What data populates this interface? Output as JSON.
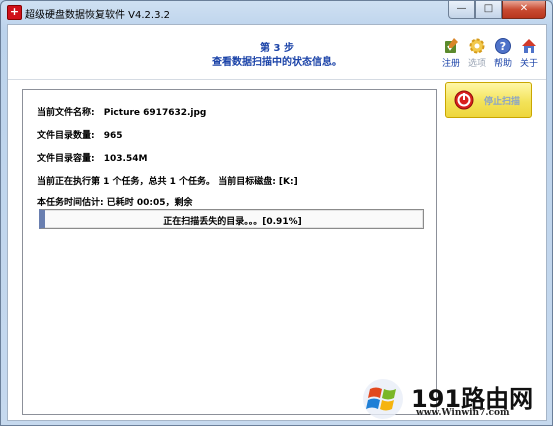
{
  "window": {
    "title": "超级硬盘数据恢复软件 V4.2.3.2",
    "controls": {
      "minimize": "—",
      "maximize": "□",
      "close": "✕"
    }
  },
  "header": {
    "step": "第 3 步",
    "subtitle": "查看数据扫描中的状态信息。"
  },
  "toolbar": {
    "items": [
      {
        "label": "注册",
        "icon": "register-icon",
        "enabled": true
      },
      {
        "label": "选项",
        "icon": "options-gear-icon",
        "enabled": false
      },
      {
        "label": "帮助",
        "icon": "help-icon",
        "enabled": true
      },
      {
        "label": "关于",
        "icon": "about-house-icon",
        "enabled": true
      }
    ]
  },
  "status": {
    "current_file_label": "当前文件名称:",
    "current_file_value": "Picture 6917632.jpg",
    "dir_count_label": "文件目录数量:",
    "dir_count_value": "965",
    "dir_size_label": "文件目录容量:",
    "dir_size_value": "103.54M",
    "task_line": "当前正在执行第 1 个任务，总共 1 个任务。 当前目标磁盘: [K:]",
    "time_line": "本任务时间估计: 已耗时 00:05，剩余"
  },
  "progress": {
    "text": "正在扫描丢失的目录。。。[0.91%]",
    "fraction": 0.0091
  },
  "stop_button": {
    "label": "停止扫描"
  },
  "watermark": {
    "brand": "191路由网",
    "url": "www.Winwin7.com"
  },
  "colors": {
    "accent_blue": "#1b43a8",
    "stop_button_bg": "#f3e35a",
    "close_button": "#c94b32"
  }
}
